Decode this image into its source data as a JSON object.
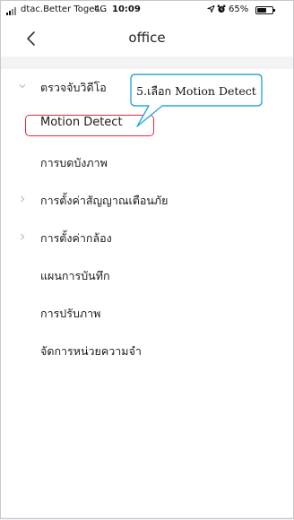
{
  "status_bar": {
    "carrier": "dtac.Better Toget...",
    "network": "4G",
    "time": "10:09",
    "battery_percent": "65%",
    "battery_level": 0.65,
    "icons": [
      "signal-bars-icon",
      "location-arrow-icon",
      "alarm-clock-icon",
      "battery-icon"
    ]
  },
  "nav": {
    "title": "office",
    "back_icon": "chevron-left-icon"
  },
  "menu": {
    "items": [
      {
        "label": "ตรวจจับวิดีโอ",
        "chevron": "chevron-down-icon",
        "expanded": true
      },
      {
        "label": "Motion Detect",
        "chevron": null
      },
      {
        "label": "การบดบังภาพ",
        "chevron": null
      },
      {
        "label": "การตั้งค่าสัญญาณเตือนภัย",
        "chevron": "chevron-right-icon"
      },
      {
        "label": "การตั้งค่ากล้อง",
        "chevron": "chevron-right-icon"
      },
      {
        "label": "แผนการบันทึก",
        "chevron": null
      },
      {
        "label": "การปรับภาพ",
        "chevron": null
      },
      {
        "label": "จัดการหน่วยความจำ",
        "chevron": null
      }
    ]
  },
  "annotation": {
    "callout_text": "5.เลือก Motion Detect",
    "callout_color": "#2aa7e0",
    "highlight_color": "#e52a3a",
    "highlighted_item": "Motion Detect"
  },
  "colors": {
    "background": "#f3f3f5",
    "surface": "#ffffff",
    "chevron": "#b8b8bc"
  }
}
